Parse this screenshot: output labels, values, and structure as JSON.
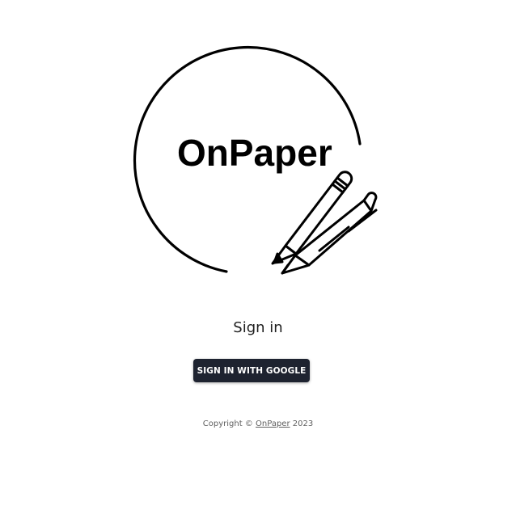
{
  "brand": {
    "logo_text": "OnPaper"
  },
  "signin": {
    "title": "Sign in",
    "google_button_label": "SIGN IN WITH GOOGLE"
  },
  "footer": {
    "copyright_prefix": "Copyright ©",
    "copyright_link": "OnPaper",
    "copyright_year": "2023"
  },
  "colors": {
    "button_bg": "#1e2330",
    "button_text": "#ffffff",
    "text": "#1f1f1f",
    "muted_text": "#5f5f5f"
  }
}
